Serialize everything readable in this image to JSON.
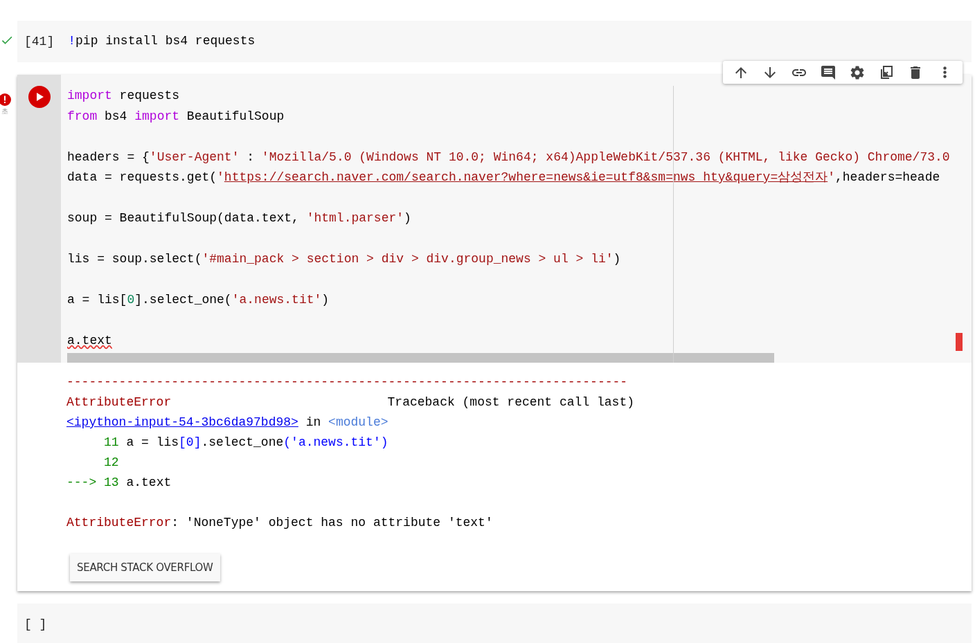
{
  "cells": [
    {
      "succeeded": true,
      "counter": "[41]",
      "blocks": [
        {
          "lines": [
            {
              "tokens": [
                {
                  "kind": "bang",
                  "text": "!"
                },
                {
                  "kind": "plain",
                  "text": "pip install bs4 requests"
                }
              ]
            }
          ]
        }
      ]
    },
    {
      "failed": true,
      "status_note": "초",
      "focused": true,
      "blocks": [
        {
          "lines": [
            {
              "tokens": [
                {
                  "kind": "keyword",
                  "text": "import"
                },
                {
                  "kind": "plain",
                  "text": " requests"
                }
              ]
            },
            {
              "tokens": [
                {
                  "kind": "keyword",
                  "text": "from"
                },
                {
                  "kind": "plain",
                  "text": " bs4 "
                },
                {
                  "kind": "keyword",
                  "text": "import"
                },
                {
                  "kind": "plain",
                  "text": " BeautifulSoup"
                }
              ]
            }
          ]
        },
        {
          "lines": [
            {
              "tokens": [
                {
                  "kind": "plain",
                  "text": "headers = {"
                },
                {
                  "kind": "string",
                  "text": "'User-Agent'"
                },
                {
                  "kind": "plain",
                  "text": " : "
                },
                {
                  "kind": "string",
                  "text": "'Mozilla/5.0 (Windows NT 10.0; Win64; x64)AppleWebKit/537.36 (KHTML, like Gecko) Chrome/73.0"
                }
              ]
            },
            {
              "tokens": [
                {
                  "kind": "plain",
                  "text": "data = requests.get("
                },
                {
                  "kind": "string",
                  "text": "'"
                },
                {
                  "kind": "link",
                  "text": "https://search.naver.com/search.naver?where=news&ie=utf8&sm=nws_hty&query=삼성전자"
                },
                {
                  "kind": "string",
                  "text": "'"
                },
                {
                  "kind": "plain",
                  "text": ",headers=heade"
                }
              ]
            }
          ]
        },
        {
          "lines": [
            {
              "tokens": [
                {
                  "kind": "plain",
                  "text": "soup = BeautifulSoup(data.text, "
                },
                {
                  "kind": "string",
                  "text": "'html.parser'"
                },
                {
                  "kind": "plain",
                  "text": ")"
                }
              ]
            }
          ]
        },
        {
          "lines": [
            {
              "tokens": [
                {
                  "kind": "plain",
                  "text": "lis = soup.select("
                },
                {
                  "kind": "string",
                  "text": "'#main_pack > section > div > div.group_news > ul > li'"
                },
                {
                  "kind": "plain",
                  "text": ")"
                }
              ]
            }
          ]
        },
        {
          "lines": [
            {
              "tokens": [
                {
                  "kind": "plain",
                  "text": "a = lis["
                },
                {
                  "kind": "number",
                  "text": "0"
                },
                {
                  "kind": "plain",
                  "text": "].select_one("
                },
                {
                  "kind": "string",
                  "text": "'a.news.tit'"
                },
                {
                  "kind": "plain",
                  "text": ")"
                }
              ]
            }
          ]
        },
        {
          "lines": [
            {
              "tokens": [
                {
                  "kind": "flagged",
                  "text": "a.text"
                }
              ]
            }
          ]
        }
      ],
      "output": {
        "rule": "---------------------------------------------------------------------------",
        "error_name": "AttributeError",
        "traceback_label": "Traceback (most recent call last)",
        "trace": [
          {
            "tokens": [
              {
                "kind": "tblink",
                "text": "<ipython-input-54-3bc6da97bd98>"
              },
              {
                "kind": "plain",
                "text": " in "
              },
              {
                "kind": "module",
                "text": "<module>"
              }
            ]
          },
          {
            "tokens": [
              {
                "kind": "lineno",
                "text": "     11"
              },
              {
                "kind": "plain",
                "text": " a = lis"
              },
              {
                "kind": "blue",
                "text": "[0]"
              },
              {
                "kind": "plain",
                "text": ".select_one"
              },
              {
                "kind": "blue",
                "text": "('a.news.tit')"
              }
            ]
          },
          {
            "tokens": [
              {
                "kind": "lineno",
                "text": "     12"
              }
            ]
          },
          {
            "tokens": [
              {
                "kind": "lineno",
                "text": "---> 13"
              },
              {
                "kind": "plain",
                "text": " a.text"
              }
            ]
          }
        ],
        "message": {
          "tokens": [
            {
              "kind": "error",
              "text": "AttributeError"
            },
            {
              "kind": "plain",
              "text": ": 'NoneType' object has no attribute 'text'"
            }
          ]
        },
        "action_button": "SEARCH STACK OVERFLOW"
      }
    },
    {
      "counter": "[ ]"
    }
  ]
}
